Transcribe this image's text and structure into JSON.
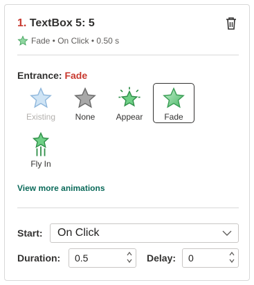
{
  "header": {
    "number": "1.",
    "title": "TextBox 5: 5",
    "summary": "Fade • On Click • 0.50 s"
  },
  "entrance": {
    "label": "Entrance:",
    "value": "Fade",
    "effects": [
      {
        "label": "Existing",
        "state": "disabled",
        "icon": "star-existing-icon"
      },
      {
        "label": "None",
        "state": "normal",
        "icon": "star-none-icon"
      },
      {
        "label": "Appear",
        "state": "normal",
        "icon": "star-appear-icon"
      },
      {
        "label": "Fade",
        "state": "selected",
        "icon": "star-fade-icon"
      },
      {
        "label": "Fly In",
        "state": "normal",
        "icon": "star-fly-in-icon"
      }
    ],
    "more_link": "View more animations"
  },
  "timing": {
    "start_label": "Start:",
    "start_value": "On Click",
    "duration_label": "Duration:",
    "duration_value": "0.5",
    "delay_label": "Delay:",
    "delay_value": "0"
  },
  "icons": {
    "delete": "trash-icon",
    "dropdown": "chevron-down-icon",
    "spin_up": "chevron-up-icon",
    "spin_down": "chevron-down-icon"
  },
  "colors": {
    "accent_red": "#c8382e",
    "link_green": "#0b6a5a",
    "star_green": "#5bbf73",
    "star_gray": "#9e9e9e",
    "star_blue": "#bcd9f0"
  }
}
